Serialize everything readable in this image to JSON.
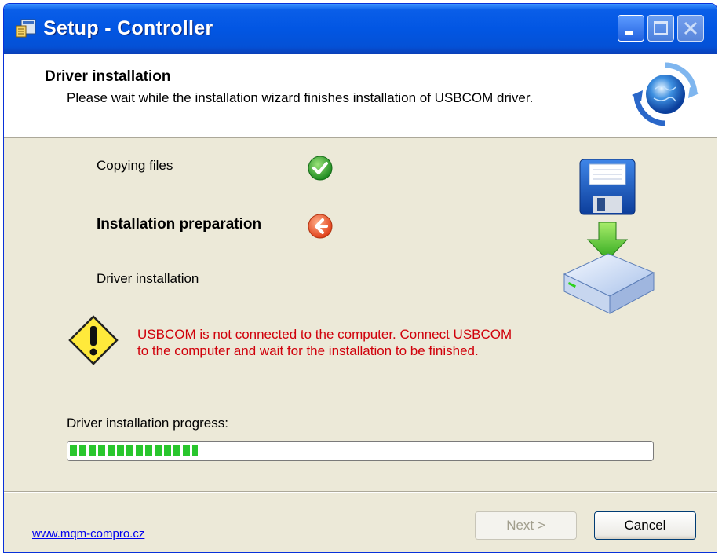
{
  "window": {
    "title": "Setup - Controller",
    "icon": "setup-app-icon"
  },
  "titlebar_buttons": {
    "minimize": "minimize-icon",
    "maximize": "maximize-icon",
    "close": "close-icon"
  },
  "header": {
    "title": "Driver installation",
    "subtitle": "Please wait while the installation wizard finishes installation of USBCOM driver.",
    "icon": "globe-refresh-icon"
  },
  "steps": [
    {
      "label": "Copying files",
      "status": "done",
      "icon": "check-icon"
    },
    {
      "label": "Installation preparation",
      "status": "current",
      "icon": "arrow-left-icon"
    },
    {
      "label": "Driver installation",
      "status": "pending",
      "icon": ""
    }
  ],
  "warning": {
    "icon": "warning-icon",
    "line1": "USBCOM is not connected to the computer. Connect USBCOM",
    "line2": "to the computer and wait for the installation to be finished.",
    "color": "#d0000a"
  },
  "progress": {
    "label": "Driver installation progress:",
    "fraction": 0.22,
    "color": "#29c62d"
  },
  "footer": {
    "link": "www.mqm-compro.cz",
    "next_label": "Next >",
    "cancel_label": "Cancel"
  },
  "colors": {
    "titlebar": "#0256e3",
    "window_bg": "#ece9d8"
  }
}
